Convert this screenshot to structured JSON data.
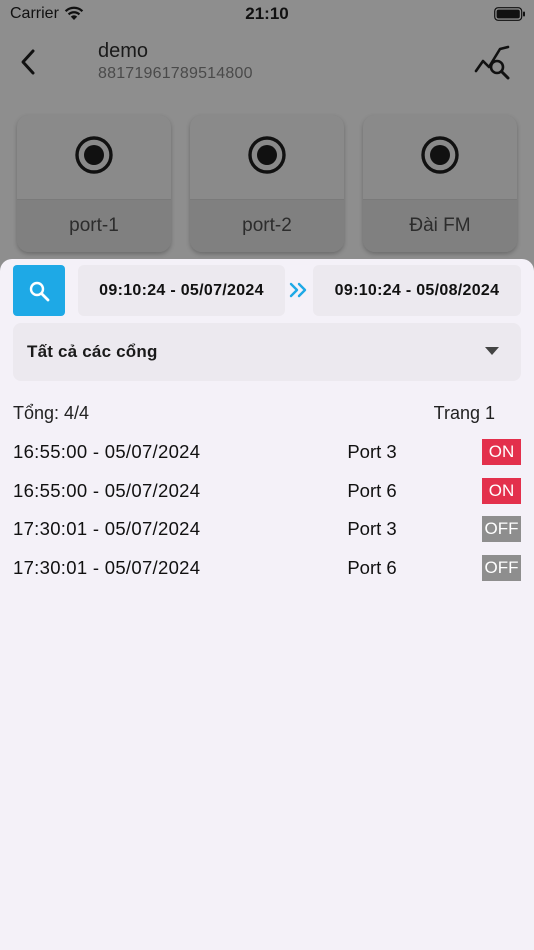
{
  "status_bar": {
    "carrier": "Carrier",
    "time": "21:10"
  },
  "header": {
    "device_name": "demo",
    "device_id": "88171961789514800"
  },
  "ports": [
    {
      "label": "port-1"
    },
    {
      "label": "port-2"
    },
    {
      "label": "Đài FM"
    }
  ],
  "filter": {
    "from": "09:10:24 - 05/07/2024",
    "to": "09:10:24 - 05/08/2024",
    "port_select": "Tất cả các cổng"
  },
  "summary": {
    "total": "Tổng: 4/4",
    "page": "Trang 1"
  },
  "logs": [
    {
      "time": "16:55:00 - 05/07/2024",
      "port": "Port 3",
      "status": "ON"
    },
    {
      "time": "16:55:00 - 05/07/2024",
      "port": "Port 6",
      "status": "ON"
    },
    {
      "time": "17:30:01 - 05/07/2024",
      "port": "Port 3",
      "status": "OFF"
    },
    {
      "time": "17:30:01 - 05/07/2024",
      "port": "Port 6",
      "status": "OFF"
    }
  ],
  "colors": {
    "accent": "#1ea9e6",
    "on": "#e3304c",
    "off": "#8e8e8e",
    "sheet": "#f4f1f8"
  },
  "icons": [
    "wifi-icon",
    "battery-icon",
    "back-icon",
    "search-chart-icon",
    "radio-icon",
    "search-icon",
    "double-chevron-right-icon",
    "dropdown-icon"
  ]
}
